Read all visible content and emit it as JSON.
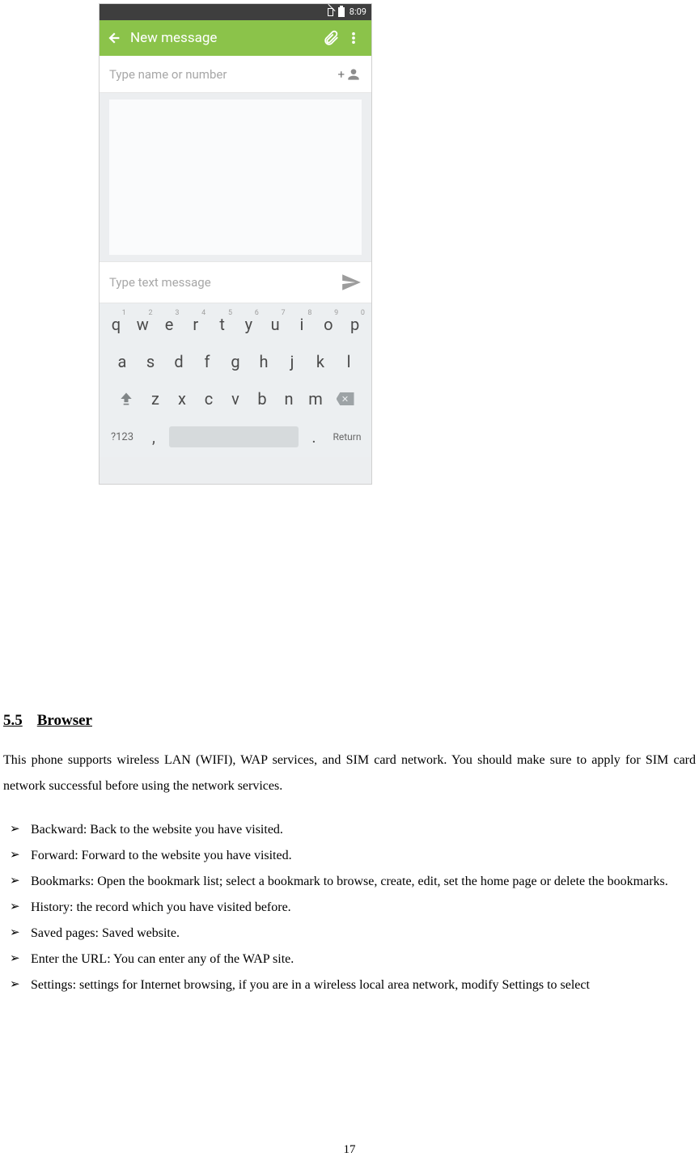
{
  "status": {
    "time": "8:09"
  },
  "appbar": {
    "title": "New message"
  },
  "recipient": {
    "placeholder": "Type name or number"
  },
  "compose": {
    "placeholder": "Type text message"
  },
  "keyboard": {
    "row1": [
      {
        "main": "q",
        "sup": "1"
      },
      {
        "main": "w",
        "sup": "2"
      },
      {
        "main": "e",
        "sup": "3"
      },
      {
        "main": "r",
        "sup": "4"
      },
      {
        "main": "t",
        "sup": "5"
      },
      {
        "main": "y",
        "sup": "6"
      },
      {
        "main": "u",
        "sup": "7"
      },
      {
        "main": "i",
        "sup": "8"
      },
      {
        "main": "o",
        "sup": "9"
      },
      {
        "main": "p",
        "sup": "0"
      }
    ],
    "row2": [
      "a",
      "s",
      "d",
      "f",
      "g",
      "h",
      "j",
      "k",
      "l"
    ],
    "row3": [
      "z",
      "x",
      "c",
      "v",
      "b",
      "n",
      "m"
    ],
    "sym": "?123",
    "comma": ",",
    "dot": ".",
    "ret": "Return"
  },
  "section": {
    "num": "5.5",
    "title": "Browser",
    "intro": "This phone supports wireless LAN (WIFI), WAP services, and SIM card network. You should make sure to apply for SIM card network successful before using the network services.",
    "items": [
      "Backward: Back to the website you have visited.",
      "Forward: Forward to the website you have visited.",
      "Bookmarks: Open the bookmark list; select a bookmark to browse, create, edit, set the home page or delete the bookmarks.",
      "History: the record which you have visited before.",
      "Saved pages: Saved website.",
      "Enter the URL: You can enter any of the WAP site.",
      "Settings: settings for Internet browsing, if you are in a wireless local area network, modify Settings to select"
    ]
  },
  "pagenum": "17"
}
